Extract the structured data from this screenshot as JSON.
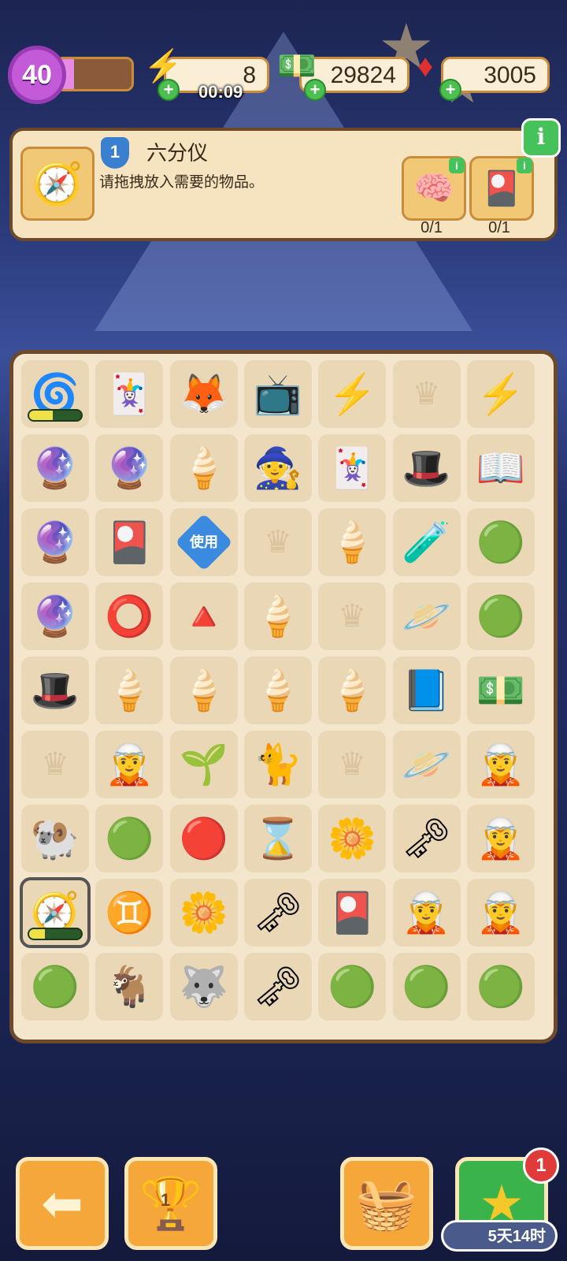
{
  "top_bar": {
    "level": "40",
    "xp_progress": 0.22,
    "energy": {
      "icon": "lightning-icon",
      "value": "8",
      "timer": "00:09"
    },
    "cash": {
      "icon": "cash-stack-icon",
      "value": "29824"
    },
    "gems": {
      "icon": "ruby-icon",
      "value": "3005"
    }
  },
  "task": {
    "level": "1",
    "title": "六分仪",
    "description": "请拖拽放入需要的物品。",
    "item_icon": "sextant-icon",
    "requirements": [
      {
        "icon": "brain-jar-icon",
        "count": "0/1"
      },
      {
        "icon": "tarot-cards-icon",
        "count": "0/1"
      }
    ],
    "info_label": "i"
  },
  "board": {
    "use_label": "使用",
    "cells": [
      [
        "🌀",
        "🃏",
        "🦊",
        "📺",
        "⚡",
        "",
        "⚡"
      ],
      [
        "🔮",
        "🔮",
        "🍦",
        "🧙",
        "🃏",
        "🎩",
        "📖"
      ],
      [
        "🔮",
        "🎴",
        "USE",
        "",
        "🍦",
        "🧪",
        "🟢"
      ],
      [
        "🔮",
        "⭕",
        "🔺",
        "🍦",
        "",
        "🪐",
        "🟢"
      ],
      [
        "🎩",
        "🍦",
        "🍦",
        "🍦",
        "🍦",
        "📘",
        "💵"
      ],
      [
        "",
        "🧝",
        "🌱",
        "🐈",
        "",
        "🪐",
        "🧝"
      ],
      [
        "🐏",
        "🟢",
        "🔴",
        "⌛",
        "🌼",
        "🗝",
        "🧝"
      ],
      [
        "🧭",
        "♊",
        "🌼",
        "🗝",
        "🎴",
        "🧝",
        "🧝"
      ],
      [
        "🟢",
        "🐐",
        "🐺",
        "🗝",
        "🟢",
        "🟢",
        "🟢"
      ]
    ],
    "progress_cells": [
      {
        "row": 0,
        "col": 0,
        "progress": 0.45
      },
      {
        "row": 7,
        "col": 0,
        "progress": 0.3
      }
    ]
  },
  "bottom": {
    "back_icon": "back-arrow-icon",
    "trophy_icon": "trophy-icon",
    "trophy_number": "1",
    "basket_icon": "basket-icon",
    "star_icon": "star-icon",
    "star_badge": "1",
    "event_timer": "5天14时"
  }
}
